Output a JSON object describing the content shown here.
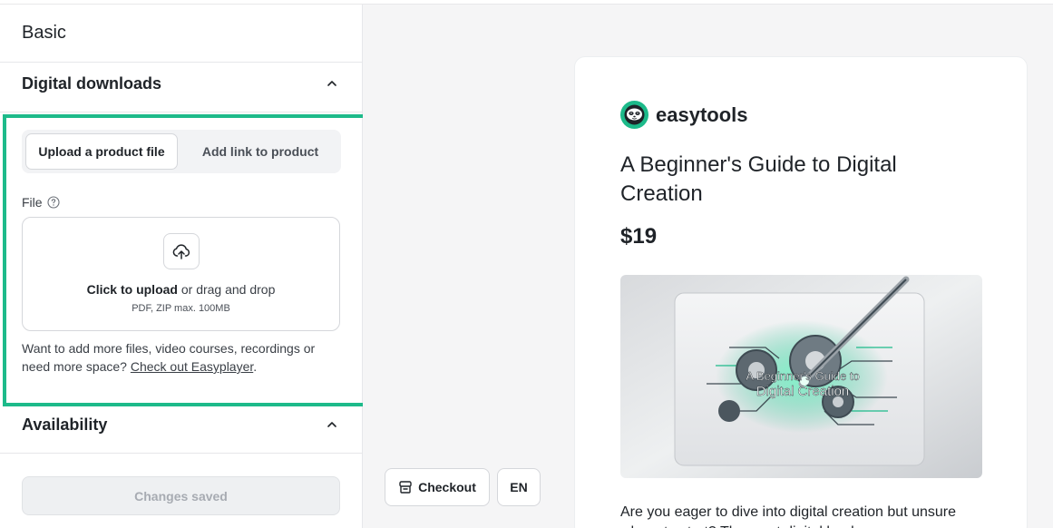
{
  "sidebar": {
    "basic_label": "Basic",
    "digital_downloads_label": "Digital downloads",
    "tabs": [
      {
        "label": "Upload a product file",
        "active": true
      },
      {
        "label": "Add link to product",
        "active": false
      }
    ],
    "file_label": "File",
    "dropzone": {
      "click_text": "Click to upload",
      "rest_text": " or drag and drop",
      "hint": "PDF, ZIP max. 100MB"
    },
    "more_text": "Want to add more files, video courses, recordings or need more space? ",
    "more_link": "Check out Easyplayer",
    "more_end": ".",
    "availability_label": "Availability",
    "save_status": "Changes saved"
  },
  "preview": {
    "checkout_label": "Checkout",
    "language": "EN",
    "brand_name": "easytools",
    "product_title": "A Beginner's Guide to Digital Creation",
    "price": "$19",
    "cover_title_line1": "A Beginner's Guide to",
    "cover_title_line2": "Digital Creation",
    "description": "Are you eager to dive into digital creation but unsure where to start? The most digital book..."
  },
  "colors": {
    "highlight": "#1dba8a",
    "brand_green": "#1dba8a"
  }
}
